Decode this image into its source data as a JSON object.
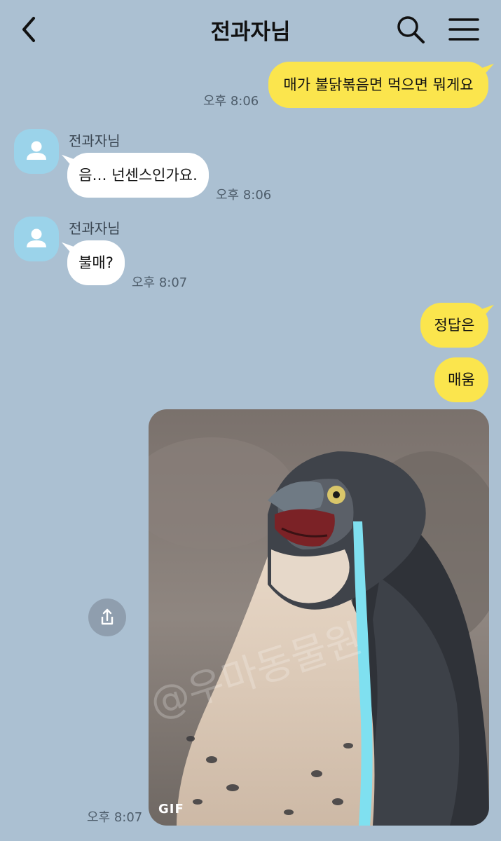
{
  "header": {
    "title": "전과자님",
    "back_icon": "chevron-left-icon",
    "search_icon": "search-icon",
    "menu_icon": "hamburger-menu-icon"
  },
  "colors": {
    "background": "#abc0d2",
    "my_bubble": "#fbe54d",
    "their_bubble": "#ffffff",
    "avatar": "#9bd3ea"
  },
  "messages": [
    {
      "from": "me",
      "text": "매가 불닭볶음면 먹으면 뭐게요",
      "time": "오후 8:06"
    },
    {
      "from": "them",
      "sender": "전과자님",
      "text": "음… 넌센스인가요.",
      "time": "오후 8:06"
    },
    {
      "from": "them",
      "sender": "전과자님",
      "text": "불매?",
      "time": "오후 8:07"
    },
    {
      "from": "me",
      "text": "정답은"
    },
    {
      "from": "me",
      "text": "매움"
    },
    {
      "from": "me",
      "type": "gif",
      "badge": "GIF",
      "time": "오후 8:07",
      "watermark": "@우마동물원"
    }
  ],
  "share_icon": "share-icon"
}
